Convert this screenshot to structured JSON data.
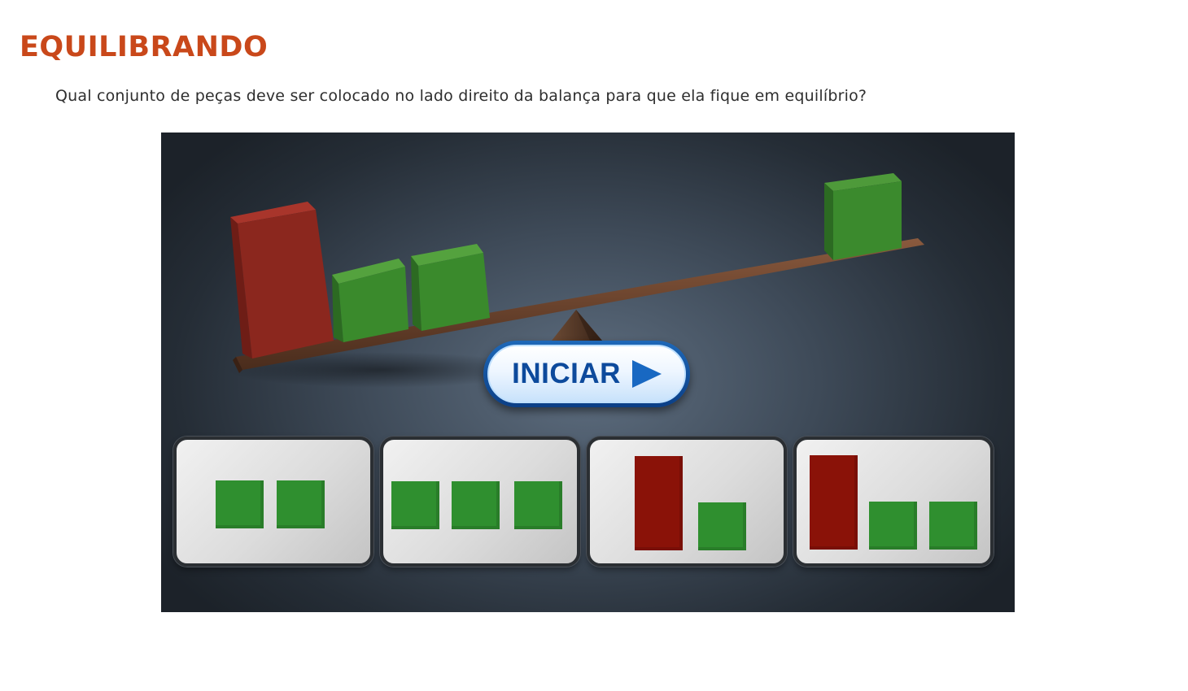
{
  "page": {
    "title": "EQUILIBRANDO",
    "question": "Qual conjunto de peças deve ser colocado no lado direito da balança para que ela fique em equilíbrio?"
  },
  "game": {
    "start_button_label": "INICIAR",
    "start_button_icon": "play-icon",
    "scale": {
      "left_pan": [
        "red-block",
        "green-cube",
        "green-cube"
      ],
      "right_pan": [
        "green-cube"
      ]
    },
    "options": [
      {
        "id": 1,
        "pieces": [
          "green",
          "green"
        ]
      },
      {
        "id": 2,
        "pieces": [
          "green",
          "green",
          "green"
        ]
      },
      {
        "id": 3,
        "pieces": [
          "red",
          "green"
        ]
      },
      {
        "id": 4,
        "pieces": [
          "red",
          "green",
          "green"
        ]
      }
    ],
    "colors": {
      "title": "#c9481a",
      "green_piece": "#2f8f2f",
      "red_piece": "#8a1208",
      "button_text": "#0d4a9c"
    }
  }
}
